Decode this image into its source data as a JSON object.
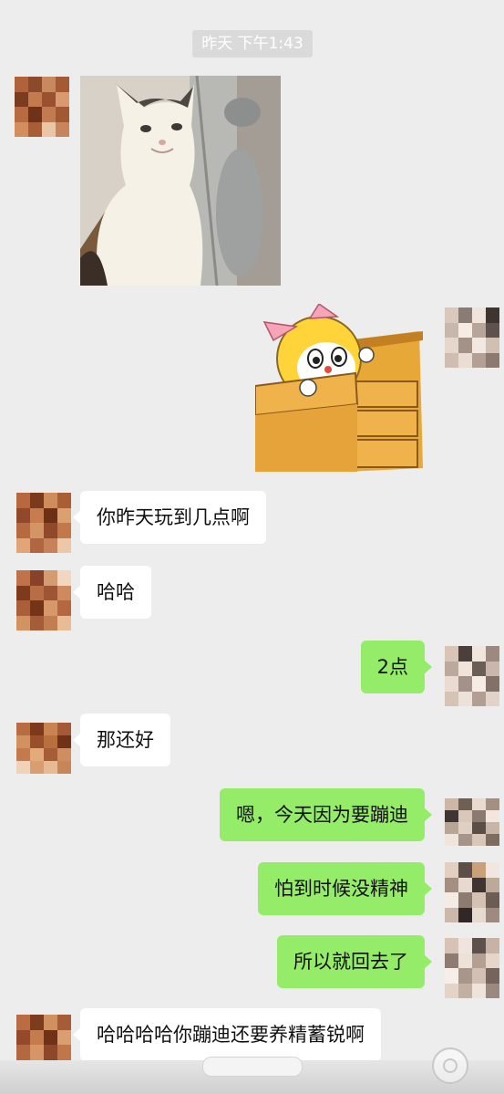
{
  "chat": {
    "timestamp": "昨天 下午1:43",
    "messages": [
      {
        "side": "left",
        "type": "image",
        "subject": "cat"
      },
      {
        "side": "right",
        "type": "sticker",
        "subject": "dorami-in-drawer"
      },
      {
        "side": "left",
        "type": "text",
        "text": "你昨天玩到几点啊"
      },
      {
        "side": "left",
        "type": "text",
        "text": "哈哈"
      },
      {
        "side": "right",
        "type": "text",
        "text": "2点"
      },
      {
        "side": "left",
        "type": "text",
        "text": "那还好"
      },
      {
        "side": "right",
        "type": "text",
        "text": "嗯，今天因为要蹦迪"
      },
      {
        "side": "right",
        "type": "text",
        "text": "怕到时候没精神"
      },
      {
        "side": "right",
        "type": "text",
        "text": "所以就回去了"
      },
      {
        "side": "left",
        "type": "text",
        "text": "哈哈哈哈你蹦迪还要养精蓄锐啊"
      }
    ]
  },
  "colors": {
    "background": "#ededed",
    "left_bubble": "#ffffff",
    "right_bubble": "#95ec69",
    "timestamp_bg": "#dadada"
  },
  "icons": [
    "floating-assist-icon"
  ]
}
